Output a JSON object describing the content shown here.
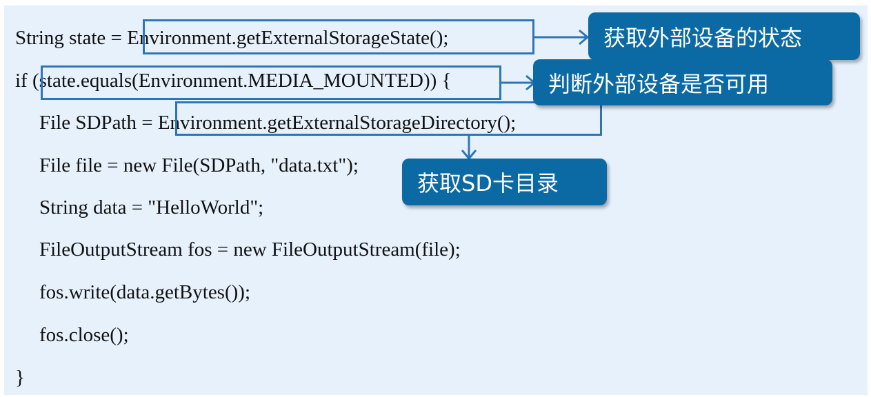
{
  "code_lines": [
    "String state = Environment.getExternalStorageState();",
    "if (state.equals(Environment.MEDIA_MOUNTED)) {",
    "File SDPath = Environment.getExternalStorageDirectory();",
    "File file = new File(SDPath, \"data.txt\");",
    "String data = \"HelloWorld\";",
    "FileOutputStream fos = new FileOutputStream(file);",
    "fos.write(data.getBytes());",
    "fos.close();",
    "}"
  ],
  "callouts": {
    "state": "获取外部设备的状态",
    "mounted": "判断外部设备是否可用",
    "directory": "获取SD卡目录"
  },
  "colors": {
    "callout": "#0b6aa3",
    "highlight_box": "#2e75b6",
    "background": "#e7f1fc"
  }
}
